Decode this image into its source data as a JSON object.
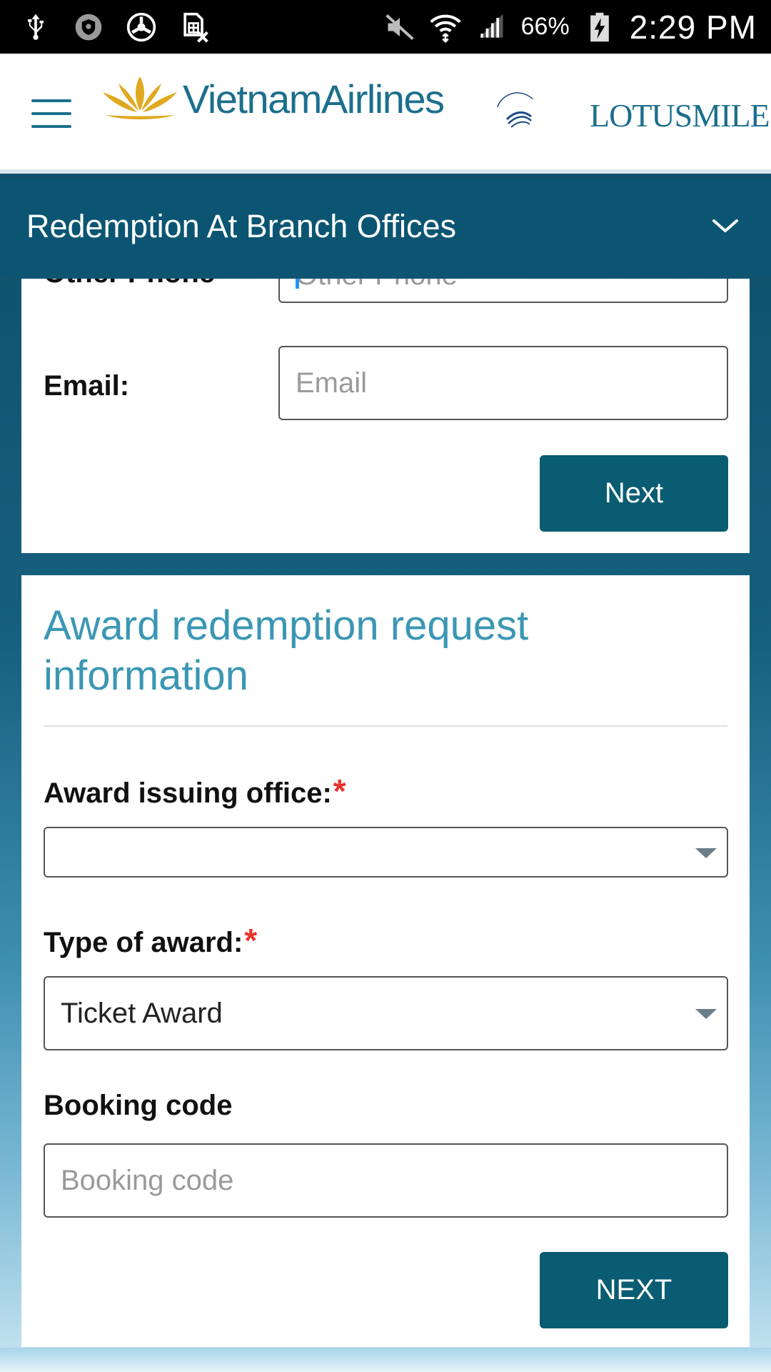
{
  "status_bar": {
    "battery": "66%",
    "time": "2:29 PM",
    "left_icons": [
      "usb-icon",
      "shield-icon",
      "sync-icon",
      "sim-off-icon"
    ],
    "right_icons": [
      "mute-icon",
      "wifi-icon",
      "signal-icon",
      "battery-charging-icon"
    ]
  },
  "header": {
    "brand": "VietnamAirlines",
    "alliance_logo": "skyteam-logo",
    "program": "LOTUSMILES"
  },
  "section": {
    "title": "Redemption At Branch Offices"
  },
  "contact_form": {
    "other_phone_label": "Other Phone",
    "other_phone_placeholder": "Other Phone",
    "email_label": "Email:",
    "email_placeholder": "Email",
    "next_label": "Next"
  },
  "award_form": {
    "heading": "Award redemption request information",
    "office_label": "Award issuing office:",
    "office_value": "",
    "required_mark": "*",
    "type_label": "Type of award:",
    "type_value": "Ticket Award",
    "booking_label": "Booking code",
    "booking_placeholder": "Booking code",
    "next_label": "NEXT"
  },
  "colors": {
    "primary": "#0a5c72",
    "section_bar": "#0b5573",
    "heading": "#3b97b4",
    "required": "#e8332e",
    "brand_gold": "#e0a81f"
  }
}
